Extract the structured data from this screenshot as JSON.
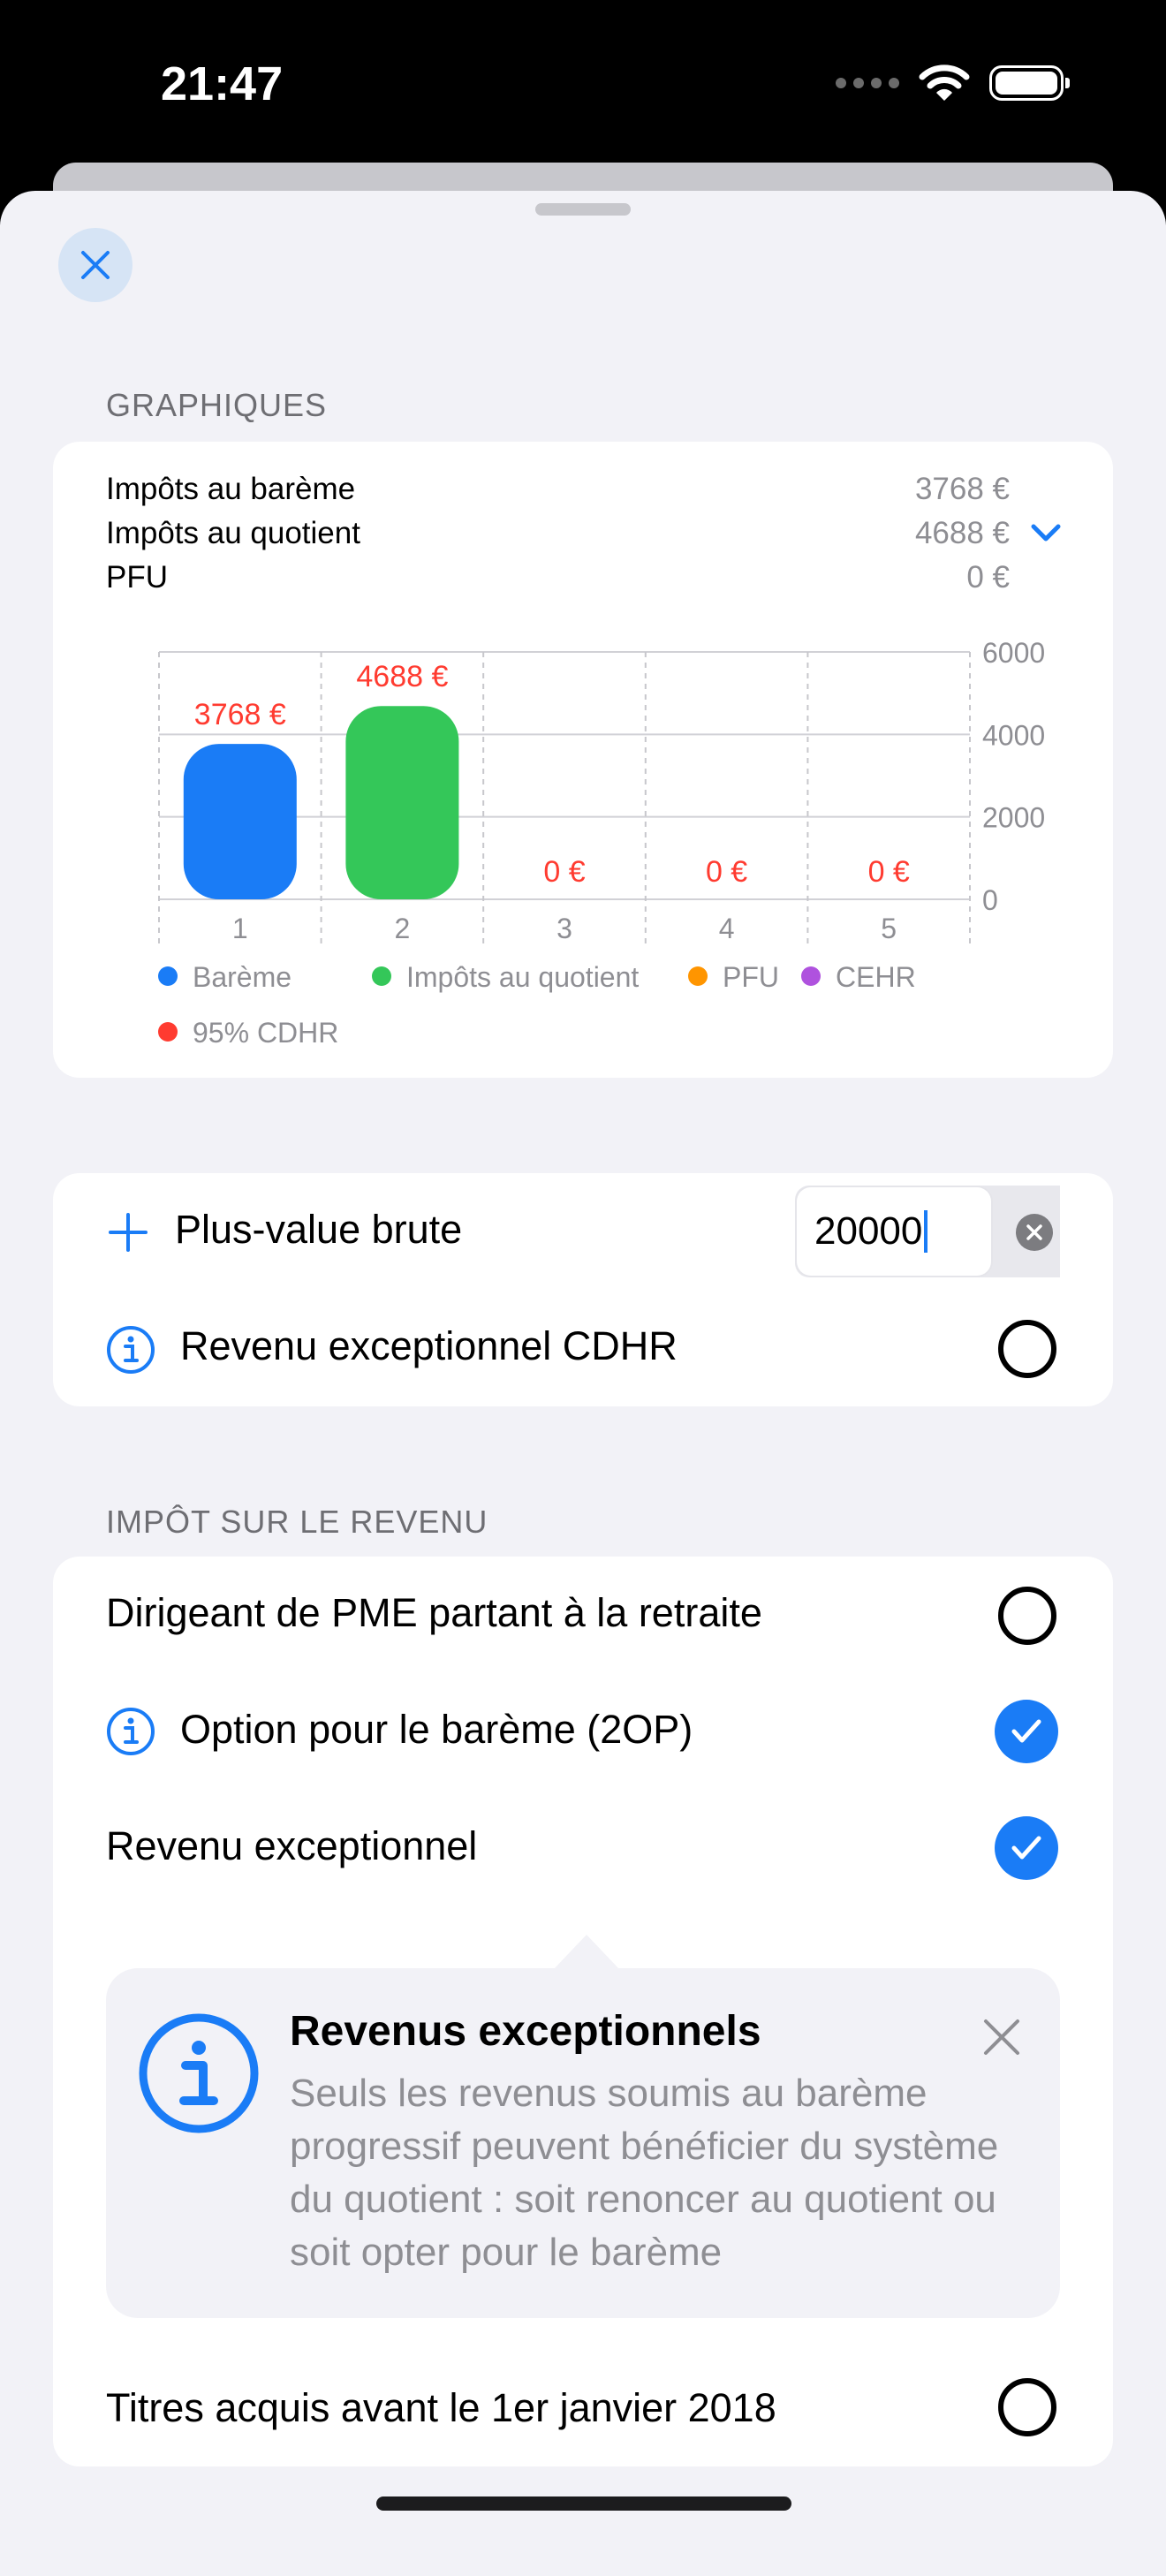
{
  "status_bar": {
    "time": "21:47"
  },
  "graphiques": {
    "header": "GRAPHIQUES",
    "summary": [
      {
        "label": "Impôts au barème",
        "value": "3768 €"
      },
      {
        "label": "Impôts au quotient",
        "value": "4688 €"
      },
      {
        "label": "PFU",
        "value": "0 €"
      }
    ]
  },
  "chart_data": {
    "type": "bar",
    "categories": [
      "1",
      "2",
      "3",
      "4",
      "5"
    ],
    "values": [
      3768,
      4688,
      0,
      0,
      0
    ],
    "data_labels": [
      "3768 €",
      "4688 €",
      "0 €",
      "0 €",
      "0 €"
    ],
    "bar_colors": [
      "#1a7cf6",
      "#34c759",
      "",
      "",
      ""
    ],
    "ylim": [
      0,
      6000
    ],
    "yticks": [
      0,
      2000,
      4000,
      6000
    ],
    "ytick_labels": [
      "0",
      "2000",
      "4000",
      "6000"
    ],
    "grid": true,
    "legend": [
      {
        "name": "Barème",
        "color": "#1a7cf6"
      },
      {
        "name": "Impôts au quotient",
        "color": "#34c759"
      },
      {
        "name": "PFU",
        "color": "#ff9500"
      },
      {
        "name": "CEHR",
        "color": "#af52de"
      },
      {
        "name": "95% CDHR",
        "color": "#ff3b30"
      }
    ],
    "legend_position": "bottom"
  },
  "inputs_card": {
    "plus_value_label": "Plus-value brute",
    "plus_value_input": "20000",
    "revenu_cdhr_label": "Revenu exceptionnel CDHR"
  },
  "impot": {
    "header": "IMPÔT SUR LE REVENU",
    "rows": [
      {
        "label": "Dirigeant de PME partant à la retraite",
        "checked": false
      },
      {
        "label": "Option pour le barème (2OP)",
        "checked": true
      },
      {
        "label": "Revenu exceptionnel",
        "checked": true
      },
      {
        "label": "Titres acquis avant le 1er janvier 2018",
        "checked": false
      }
    ]
  },
  "tip": {
    "title": "Revenus exceptionnels",
    "body": "Seuls les revenus soumis au barème progressif peuvent bénéficier du système du quotient : soit renoncer au quotient ou soit opter pour le barème"
  },
  "colors": {
    "accent": "#1a7cf6",
    "data_label": "#ff3b30"
  }
}
